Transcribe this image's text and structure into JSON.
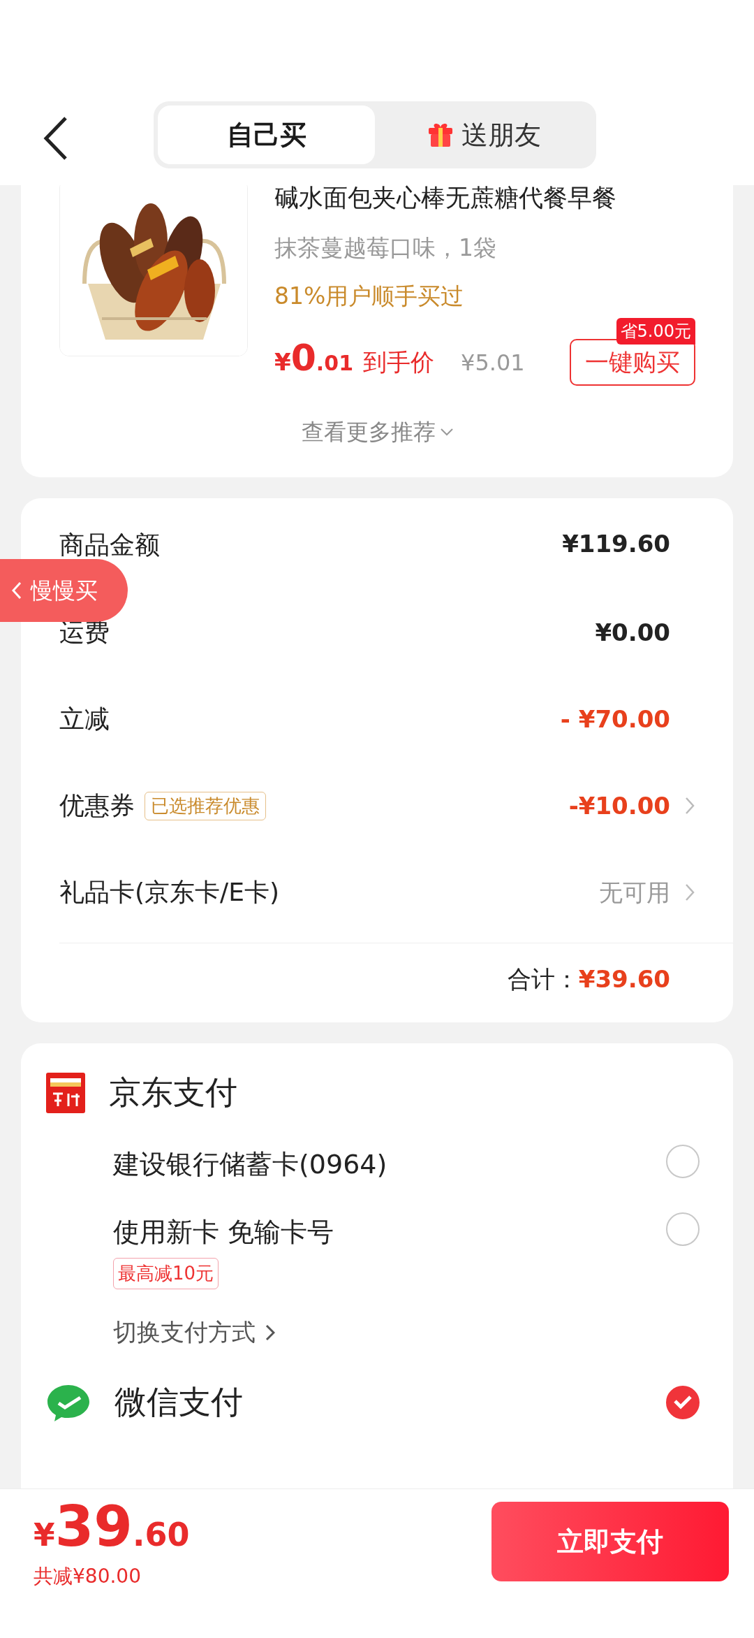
{
  "header": {
    "tabs": [
      {
        "label": "自己买",
        "selected": true
      },
      {
        "label": "送朋友",
        "selected": false
      }
    ]
  },
  "product": {
    "title": "碱水面包夹心棒无蔗糖代餐早餐",
    "spec": "抹茶蔓越莓口味，1袋",
    "social_proof": "81%用户顺手买过",
    "price_currency": "¥",
    "price_main": "0",
    "price_decimal": ".01",
    "price_label": "到手价",
    "original_price": "¥5.01",
    "save_badge": "省5.00元",
    "buy_button": "一键购买",
    "more_link": "查看更多推荐"
  },
  "floating_tab": {
    "label": "慢慢买"
  },
  "summary": {
    "rows": [
      {
        "label": "商品金额",
        "value": "¥119.60",
        "color": "#222222",
        "chevron": false
      },
      {
        "label": "运费",
        "value": "¥0.00",
        "color": "#222222",
        "chevron": false
      },
      {
        "label": "立减",
        "value": "- ¥70.00",
        "color": "#e8401c",
        "chevron": false
      },
      {
        "label": "优惠券",
        "tag": "已选推荐优惠",
        "value": "-¥10.00",
        "color": "#e8401c",
        "chevron": true
      },
      {
        "label": "礼品卡(京东卡/E卡)",
        "value": "无可用",
        "color": "#999999",
        "chevron": true
      }
    ],
    "total_label": "合计：",
    "total_value": "¥39.60"
  },
  "payment": {
    "jd_pay": {
      "title": "京东支付",
      "options": [
        {
          "label": "建设银行储蓄卡(0964)",
          "selected": false
        },
        {
          "label": "使用新卡 免输卡号",
          "badge": "最高减10元",
          "selected": false
        }
      ],
      "switch_link": "切换支付方式"
    },
    "wechat_pay": {
      "title": "微信支付",
      "selected": true
    }
  },
  "footer": {
    "currency": "¥",
    "amount_int": "39",
    "amount_dec": ".60",
    "savings": "共减¥80.00",
    "pay_button": "立即支付"
  }
}
